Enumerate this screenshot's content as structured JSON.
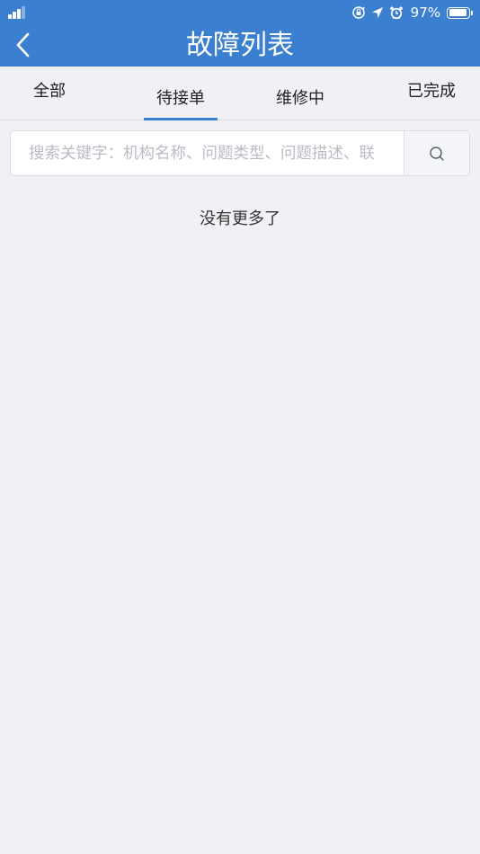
{
  "status_bar": {
    "battery_percent": "97%",
    "battery_level": 0.97,
    "signal_bars": 3,
    "icons": [
      "signal-icon",
      "rotation-lock-icon",
      "location-arrow-icon",
      "alarm-icon",
      "battery-icon"
    ]
  },
  "header": {
    "title": "故障列表",
    "back_icon": "chevron-left-icon",
    "background_color": "#3b7fd0"
  },
  "tabs": [
    {
      "label": "全部",
      "selected": false
    },
    {
      "label": "待接单",
      "selected": true
    },
    {
      "label": "维修中",
      "selected": false
    },
    {
      "label": "已完成",
      "selected": false
    }
  ],
  "search": {
    "value": "",
    "placeholder": "搜索关键字：机构名称、问题类型、问题描述、联",
    "button_icon": "search-icon"
  },
  "list": {
    "end_message": "没有更多了"
  },
  "colors": {
    "accent": "#3b7fd0",
    "page_background": "#f0f1f5"
  }
}
